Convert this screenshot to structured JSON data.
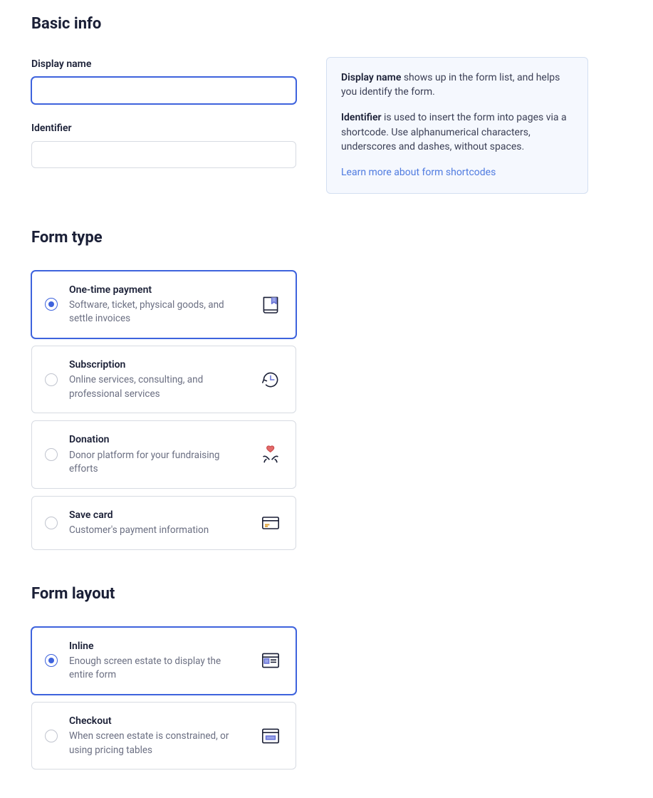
{
  "basic_info": {
    "heading": "Basic info",
    "display_name_label": "Display name",
    "display_name_value": "",
    "identifier_label": "Identifier",
    "identifier_value": ""
  },
  "help_panel": {
    "p1_strong": "Display name",
    "p1_rest": " shows up in the form list, and helps you identify the form.",
    "p2_strong": "Identifier",
    "p2_rest": " is used to insert the form into pages via a shortcode. Use alphanumerical characters, underscores and dashes, without spaces.",
    "link_text": "Learn more about form shortcodes"
  },
  "form_type": {
    "heading": "Form type",
    "options": [
      {
        "title": "One-time payment",
        "sub": "Software, ticket, physical goods, and settle invoices",
        "selected": true
      },
      {
        "title": "Subscription",
        "sub": "Online services, consulting, and professional services",
        "selected": false
      },
      {
        "title": "Donation",
        "sub": "Donor platform for your fundraising efforts",
        "selected": false
      },
      {
        "title": "Save card",
        "sub": "Customer's payment information",
        "selected": false
      }
    ]
  },
  "form_layout": {
    "heading": "Form layout",
    "options": [
      {
        "title": "Inline",
        "sub": "Enough screen estate to display the entire form",
        "selected": true
      },
      {
        "title": "Checkout",
        "sub": "When screen estate is constrained, or using pricing tables",
        "selected": false
      }
    ]
  }
}
